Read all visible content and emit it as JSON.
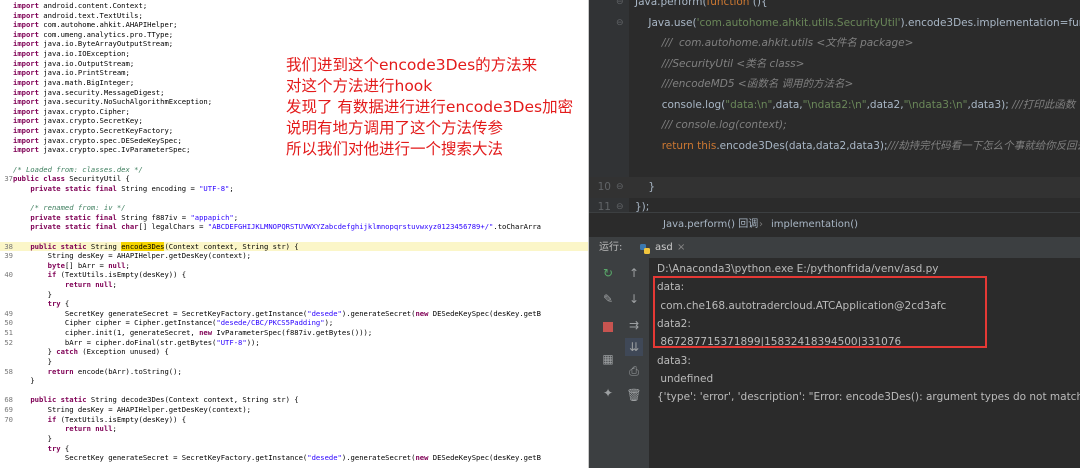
{
  "left_code": [
    {
      "ln": "",
      "t": "import android.content.Context;"
    },
    {
      "ln": "",
      "t": "import android.text.TextUtils;"
    },
    {
      "ln": "",
      "t": "import com.autohome.ahkit.AHAPIHelper;"
    },
    {
      "ln": "",
      "t": "import com.umeng.analytics.pro.TType;"
    },
    {
      "ln": "",
      "t": "import java.io.ByteArrayOutputStream;"
    },
    {
      "ln": "",
      "t": "import java.io.IOException;"
    },
    {
      "ln": "",
      "t": "import java.io.OutputStream;"
    },
    {
      "ln": "",
      "t": "import java.io.PrintStream;"
    },
    {
      "ln": "",
      "t": "import java.math.BigInteger;"
    },
    {
      "ln": "",
      "t": "import java.security.MessageDigest;"
    },
    {
      "ln": "",
      "t": "import java.security.NoSuchAlgorithmException;"
    },
    {
      "ln": "",
      "t": "import javax.crypto.Cipher;"
    },
    {
      "ln": "",
      "t": "import javax.crypto.SecretKey;"
    },
    {
      "ln": "",
      "t": "import javax.crypto.SecretKeyFactory;"
    },
    {
      "ln": "",
      "t": "import javax.crypto.spec.DESedeKeySpec;"
    },
    {
      "ln": "",
      "t": "import javax.crypto.spec.IvParameterSpec;"
    },
    {
      "ln": "",
      "t": ""
    },
    {
      "ln": "",
      "t": "/* Loaded from: classes.dex */"
    },
    {
      "ln": "37",
      "t": "public class SecurityUtil {"
    },
    {
      "ln": "",
      "t": "    private static final String encoding = \"UTF-8\";"
    },
    {
      "ln": "",
      "t": ""
    },
    {
      "ln": "",
      "t": "    /* renamed from: iv */"
    },
    {
      "ln": "",
      "t": "    private static final String f887iv = \"appapich\";"
    },
    {
      "ln": "",
      "t": "    private static final char[] legalChars = \"ABCDEFGHIJKLMNOPQRSTUVWXYZabcdefghijklmnopqrstuvwxyz0123456789+/\".toCharArra"
    },
    {
      "ln": "",
      "t": ""
    },
    {
      "ln": "38",
      "t": "    public static String encode3Des(Context context, String str) {"
    },
    {
      "ln": "39",
      "t": "        String desKey = AHAPIHelper.getDesKey(context);"
    },
    {
      "ln": "",
      "t": "        byte[] bArr = null;"
    },
    {
      "ln": "40",
      "t": "        if (TextUtils.isEmpty(desKey)) {"
    },
    {
      "ln": "",
      "t": "            return null;"
    },
    {
      "ln": "",
      "t": "        }"
    },
    {
      "ln": "",
      "t": "        try {"
    },
    {
      "ln": "49",
      "t": "            SecretKey generateSecret = SecretKeyFactory.getInstance(\"desede\").generateSecret(new DESedeKeySpec(desKey.getB"
    },
    {
      "ln": "50",
      "t": "            Cipher cipher = Cipher.getInstance(\"desede/CBC/PKCS5Padding\");"
    },
    {
      "ln": "51",
      "t": "            cipher.init(1, generateSecret, new IvParameterSpec(f887iv.getBytes()));"
    },
    {
      "ln": "52",
      "t": "            bArr = cipher.doFinal(str.getBytes(\"UTF-8\"));"
    },
    {
      "ln": "",
      "t": "        } catch (Exception unused) {"
    },
    {
      "ln": "",
      "t": "        }"
    },
    {
      "ln": "58",
      "t": "        return encode(bArr).toString();"
    },
    {
      "ln": "",
      "t": "    }"
    },
    {
      "ln": "",
      "t": ""
    },
    {
      "ln": "68",
      "t": "    public static String decode3Des(Context context, String str) {"
    },
    {
      "ln": "69",
      "t": "        String desKey = AHAPIHelper.getDesKey(context);"
    },
    {
      "ln": "70",
      "t": "        if (TextUtils.isEmpty(desKey)) {"
    },
    {
      "ln": "",
      "t": "            return null;"
    },
    {
      "ln": "",
      "t": "        }"
    },
    {
      "ln": "",
      "t": "        try {"
    },
    {
      "ln": "",
      "t": "            SecretKey generateSecret = SecretKeyFactory.getInstance(\"desede\").generateSecret(new DESedeKeySpec(desKey.getB"
    }
  ],
  "highlight_line_index": 25,
  "highlight_word": "encode3Des",
  "annotation": [
    "我们进到这个encode3Des的方法来",
    "对这个方法进行hook",
    "发现了 有数据进行进行encode3Des加密",
    "说明有地方调用了这个方法传参",
    "所以我们对他进行一个搜索大法"
  ],
  "editor_lines": [
    {
      "ln": "",
      "t": "Java.perform(function (){"
    },
    {
      "ln": "",
      "t": "    Java.use('com.autohome.ahkit.utils.SecurityUtil').encode3Des.implementation=funct"
    },
    {
      "ln": "",
      "t": "        ///  com.autohome.ahkit.utils <文件名 package>"
    },
    {
      "ln": "",
      "t": "        ///SecurityUtil <类名 class>"
    },
    {
      "ln": "",
      "t": "        ///encodeMD5 <函数名 调用的方法名>"
    },
    {
      "ln": "",
      "t": "        console.log(\"data:\\n\",data,\"\\ndata2:\\n\",data2,\"\\ndata3:\\n\",data3); ///打印此函数"
    },
    {
      "ln": "",
      "t": "        /// console.log(context);"
    },
    {
      "ln": "",
      "t": "        return this.encode3Des(data,data2,data3);///劫持完代码看一下怎么个事就给你反回去"
    },
    {
      "ln": "",
      "t": ""
    },
    {
      "ln": "10",
      "t": "    }"
    },
    {
      "ln": "11",
      "t": "});"
    },
    {
      "ln": "12",
      "t": ""
    }
  ],
  "breadcrumb": {
    "part1": "Java.perform() 回调",
    "sep": "›",
    "part2": "implementation()"
  },
  "run": {
    "label": "运行:",
    "tab": "asd",
    "close": "×"
  },
  "console_lines": [
    "D:\\Anaconda3\\python.exe E:/pythonfrida/venv/asd.py",
    "data:",
    " com.che168.autotradercloud.ATCApplication@2cd3afc",
    "data2:",
    " 867287715371899|15832418394500|331076",
    "data3:",
    " undefined",
    "{'type': 'error', 'description': \"Error: encode3Des(): argument types do not match any o"
  ],
  "colors": {
    "annotation": "#e31b1b",
    "editor_bg": "#2b2b2b",
    "tool_bg": "#3c3f41",
    "redbox": "#e53935",
    "highlight": "#f5d400"
  }
}
